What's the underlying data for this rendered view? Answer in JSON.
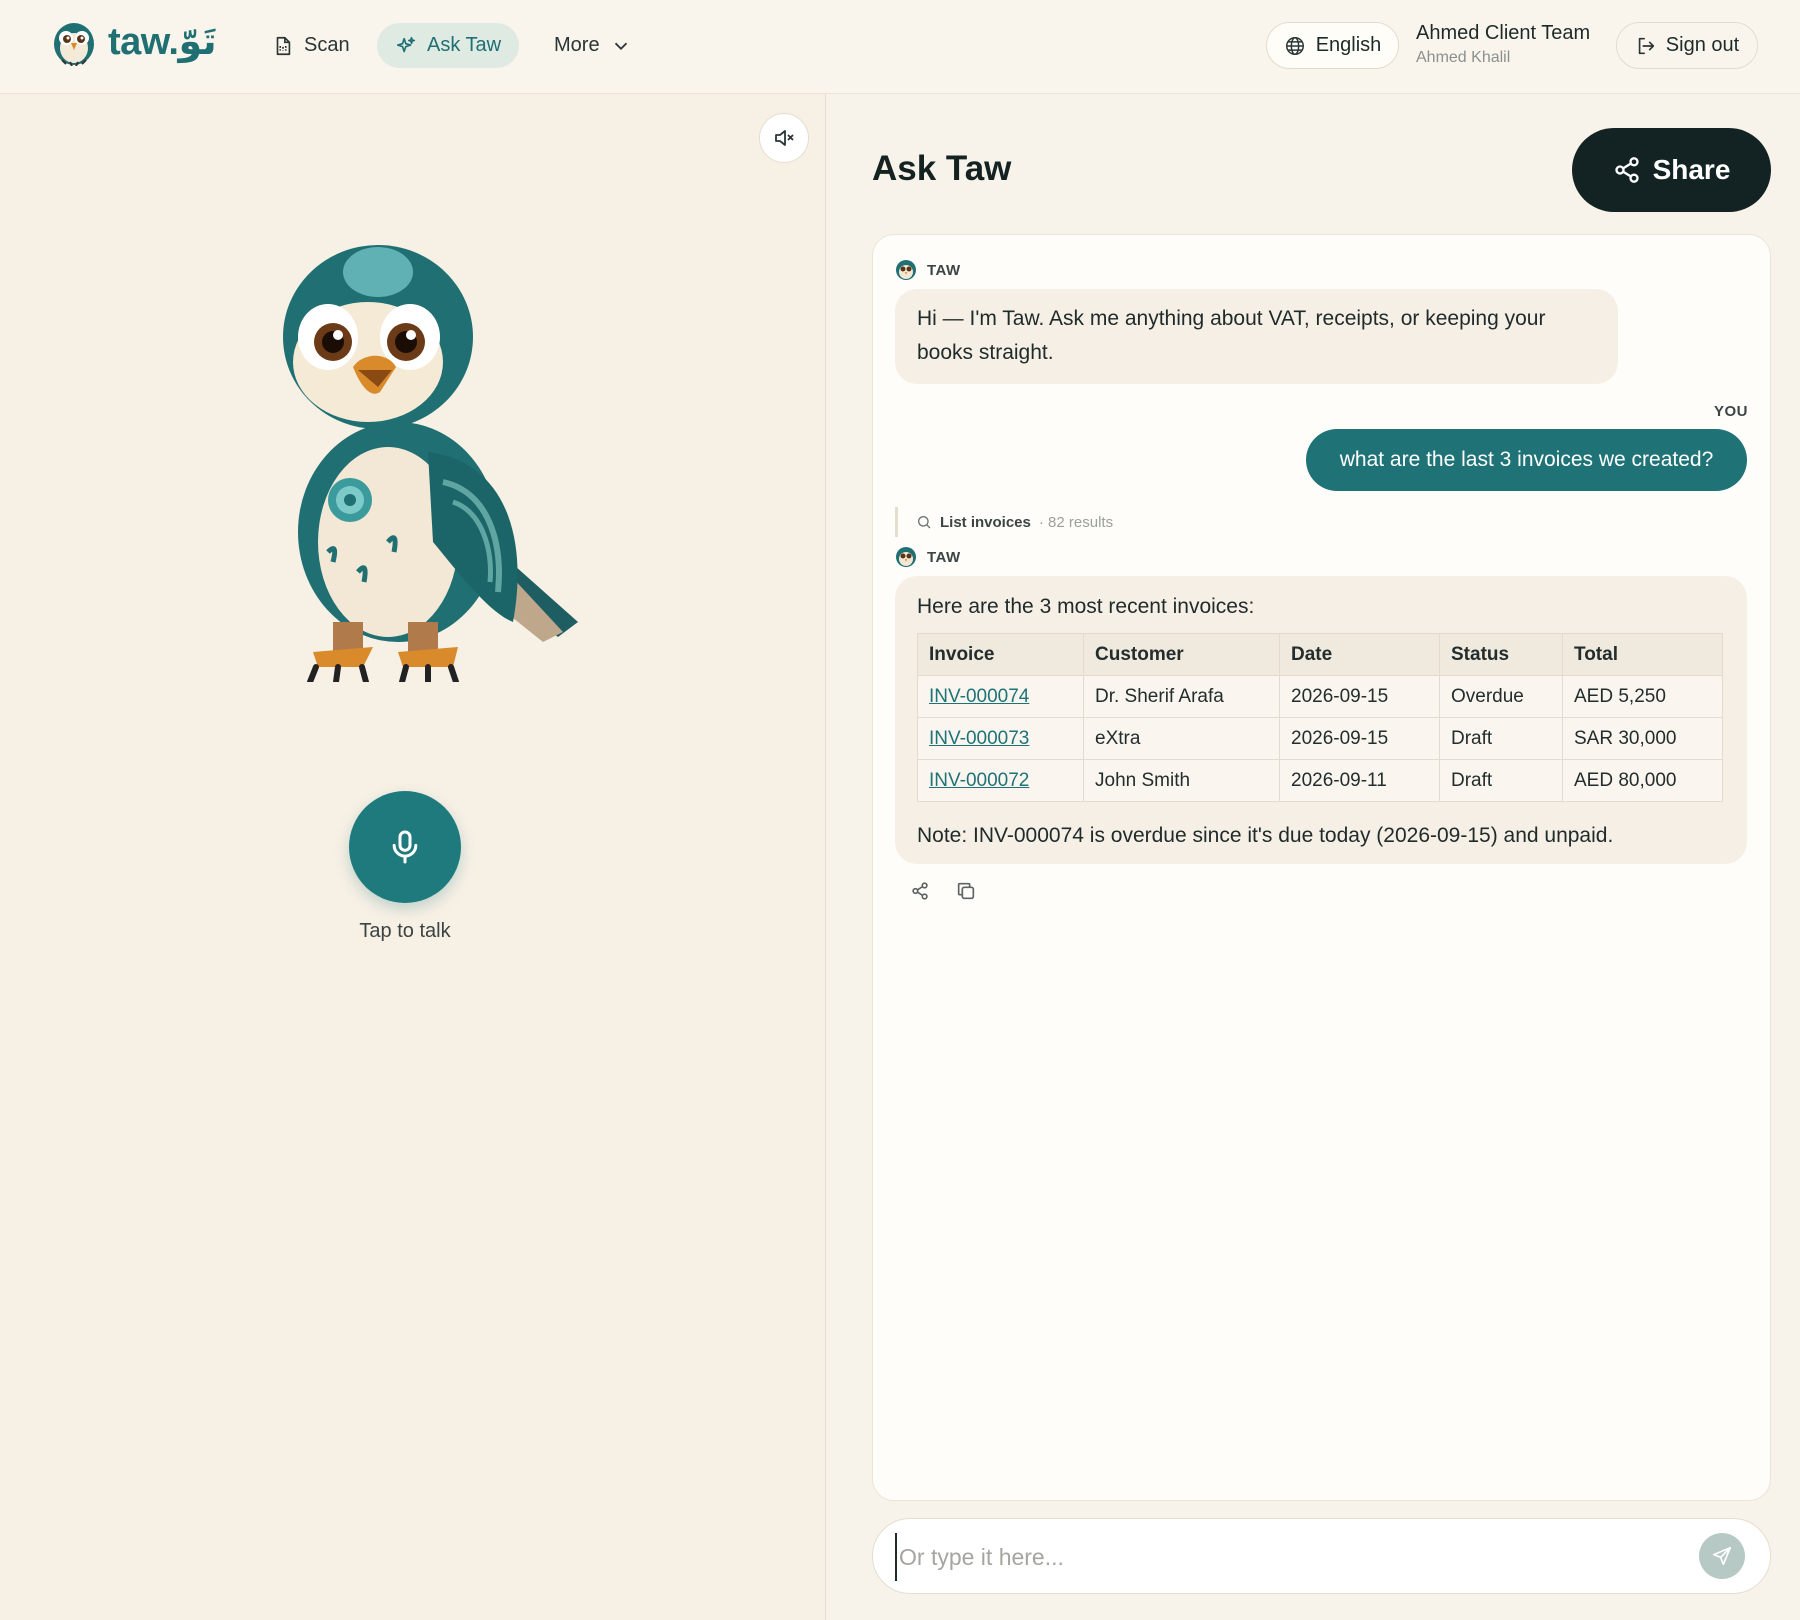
{
  "brand": {
    "name": "taw.",
    "arabic": "تَوّ"
  },
  "nav": {
    "scan": "Scan",
    "ask": "Ask Taw",
    "more": "More"
  },
  "header": {
    "language": "English",
    "team": "Ahmed Client Team",
    "user": "Ahmed Khalil",
    "signout": "Sign out"
  },
  "left": {
    "tap_to_talk": "Tap to talk"
  },
  "chat": {
    "title": "Ask Taw",
    "share": "Share",
    "taw_label": "TAW",
    "you_label": "YOU",
    "greeting": "Hi — I'm Taw. Ask me anything about VAT, receipts, or keeping your books straight.",
    "user_message": "what are the last 3 invoices we created?",
    "tool": {
      "name": "List invoices",
      "count": "· 82 results"
    },
    "answer_intro": "Here are the 3 most recent invoices:",
    "table": {
      "headers": [
        "Invoice",
        "Customer",
        "Date",
        "Status",
        "Total"
      ],
      "rows": [
        [
          "INV-000074",
          "Dr. Sherif Arafa",
          "2026-09-15",
          "Overdue",
          "AED 5,250"
        ],
        [
          "INV-000073",
          "eXtra",
          "2026-09-15",
          "Draft",
          "SAR 30,000"
        ],
        [
          "INV-000072",
          "John Smith",
          "2026-09-11",
          "Draft",
          "AED 80,000"
        ]
      ]
    },
    "note": "Note: INV-000074 is overdue since it's due today (2026-09-15) and unpaid."
  },
  "composer": {
    "placeholder": "Or type it here...",
    "value": ""
  },
  "colors": {
    "accent": "#1f7377",
    "dark": "#132323",
    "background": "#f7f1e7"
  },
  "icons": [
    "scan-icon",
    "sparkle-icon",
    "chevron-down-icon",
    "globe-icon",
    "sign-out-icon",
    "speaker-mute-icon",
    "microphone-icon",
    "share-icon",
    "search-icon",
    "copy-icon",
    "send-icon"
  ]
}
